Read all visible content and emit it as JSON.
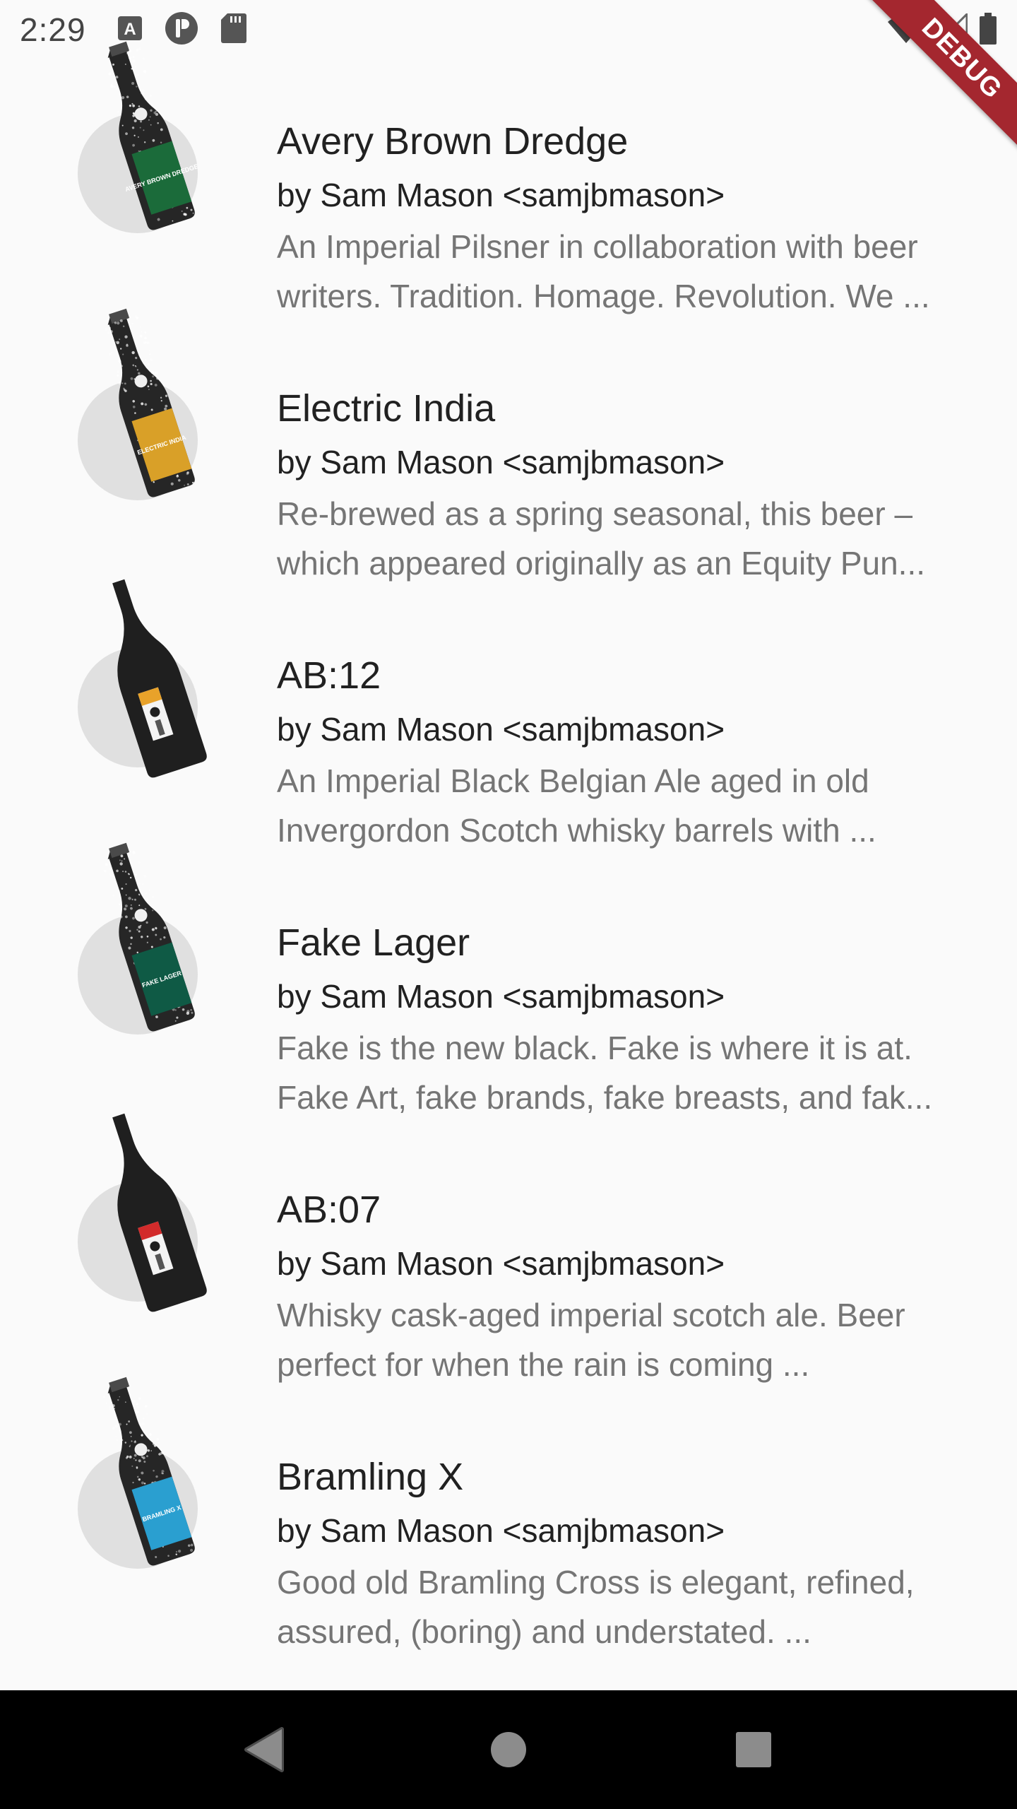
{
  "status_bar": {
    "time": "2:29",
    "left_icons": [
      "a-notification-icon",
      "circle-p-notification-icon",
      "sd-card-icon"
    ],
    "right_icons": [
      "wifi-icon",
      "cell-signal-icon",
      "battery-icon"
    ]
  },
  "debug_banner": {
    "label": "DEBUG",
    "color": "#a4272f"
  },
  "beers": [
    {
      "name": "Avery Brown Dredge",
      "byline": "by Sam Mason <samjbmason>",
      "description": "An Imperial Pilsner in collaboration with beer writers. Tradition. Homage. Revolution. We ...",
      "bottle": {
        "shape": "long-neck",
        "label_color": "#1b6b3a",
        "label_text": "AVERY BROWN DREDGE"
      }
    },
    {
      "name": "Electric India",
      "byline": "by Sam Mason <samjbmason>",
      "description": "Re-brewed as a spring seasonal, this beer – which appeared originally as an Equity Pun...",
      "bottle": {
        "shape": "long-neck",
        "label_color": "#d9a028",
        "label_text": "ELECTRIC INDIA"
      }
    },
    {
      "name": "AB:12",
      "byline": "by Sam Mason <samjbmason>",
      "description": "An Imperial Black Belgian Ale aged in old Invergordon Scotch whisky barrels with ...",
      "bottle": {
        "shape": "champagne",
        "label_color": "#e8a22a",
        "label_text": ""
      }
    },
    {
      "name": "Fake Lager",
      "byline": "by Sam Mason <samjbmason>",
      "description": "Fake is the new black. Fake is where it is at. Fake Art, fake brands, fake breasts, and fak...",
      "bottle": {
        "shape": "long-neck",
        "label_color": "#0f5a45",
        "label_text": "FAKE LAGER"
      }
    },
    {
      "name": "AB:07",
      "byline": "by Sam Mason <samjbmason>",
      "description": "Whisky cask-aged imperial scotch ale. Beer perfect for when the rain is coming ...",
      "bottle": {
        "shape": "champagne",
        "label_color": "#d22b2b",
        "label_text": ""
      }
    },
    {
      "name": "Bramling X",
      "byline": "by Sam Mason <samjbmason>",
      "description": "Good old Bramling Cross is elegant, refined, assured, (boring) and understated. ...",
      "bottle": {
        "shape": "long-neck",
        "label_color": "#2a9fd0",
        "label_text": "BRAMLING X"
      }
    }
  ],
  "nav_bar": {
    "buttons": [
      "back-icon",
      "home-icon",
      "recents-icon"
    ]
  }
}
